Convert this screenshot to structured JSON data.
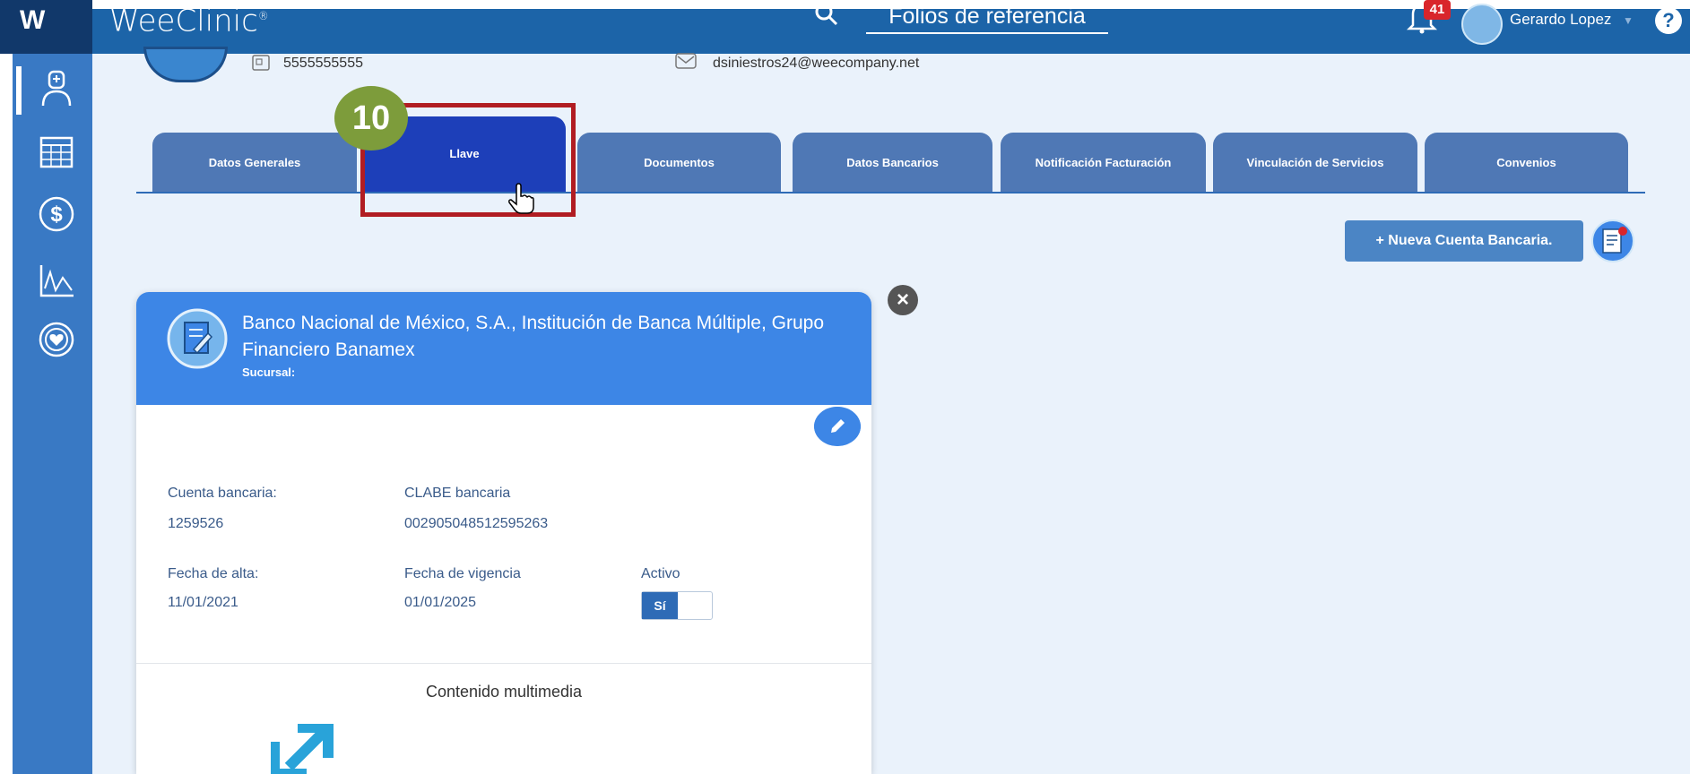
{
  "app": {
    "brand": "WeeClinic",
    "brand_mark": "W",
    "registered": "®"
  },
  "header": {
    "search_text": "Folios de referencia",
    "notifications_count": "41",
    "user_name": "Gerardo Lopez",
    "help": "?"
  },
  "profile": {
    "phone": "5555555555",
    "email": "dsiniestros24@weecompany.net"
  },
  "tabs": [
    {
      "label": "Datos Generales"
    },
    {
      "label": "Llave"
    },
    {
      "label": "Documentos"
    },
    {
      "label": "Datos Bancarios"
    },
    {
      "label": "Notificación Facturación"
    },
    {
      "label": "Vinculación de Servicios"
    },
    {
      "label": "Convenios"
    }
  ],
  "annotation": {
    "step": "10"
  },
  "actions": {
    "new_account": "+ Nueva Cuenta Bancaria."
  },
  "card": {
    "close": "×",
    "bank_name": "Banco Nacional de México, S.A., Institución de Banca Múltiple, Grupo Financiero Banamex",
    "sucursal_label": "Sucursal:",
    "cuenta_label": "Cuenta bancaria:",
    "cuenta_value": "1259526",
    "clabe_label": "CLABE bancaria",
    "clabe_value": "002905048512595263",
    "alta_label": "Fecha de alta:",
    "alta_value": "11/01/2021",
    "vigencia_label": "Fecha de vigencia",
    "vigencia_value": "01/01/2025",
    "activo_label": "Activo",
    "activo_value": "Sí",
    "multimedia_label": "Contenido multimedia"
  },
  "colors": {
    "topbar": "#1c64a8",
    "sidebar": "#3979c4",
    "tab": "#4f78b5",
    "tab_active": "#1d3fb9",
    "card_header": "#3d86e6",
    "highlight": "#b11d22",
    "step": "#7d9c3b"
  }
}
